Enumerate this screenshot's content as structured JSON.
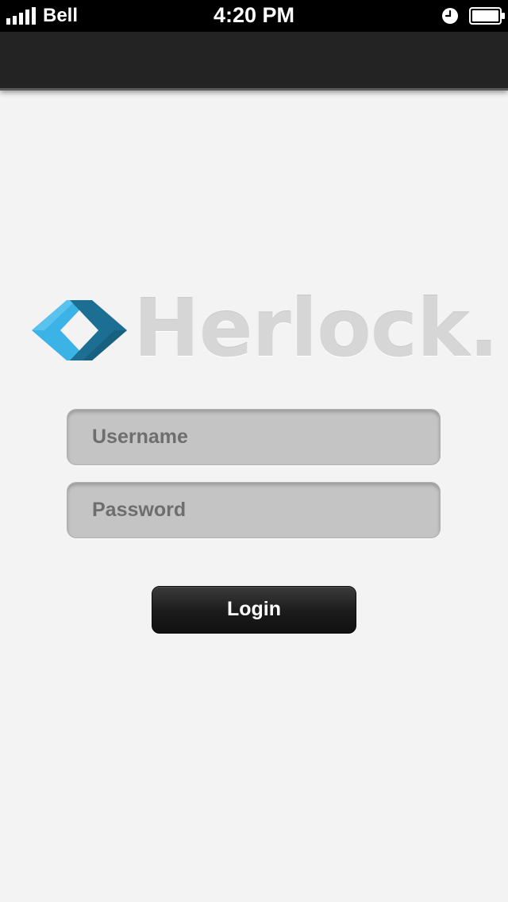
{
  "status_bar": {
    "carrier": "Bell",
    "time": "4:20 PM",
    "signal_icon": "signal-bars-icon",
    "alarm_icon": "alarm-clock-icon",
    "battery_icon": "battery-icon"
  },
  "nav_bar": {
    "background": "#232323"
  },
  "logo": {
    "text": "Herlock.",
    "mark_icon": "herlock-logo-mark-icon",
    "colors": {
      "mark_light": "#3bb3e6",
      "mark_dark": "#1c6f93",
      "wordmark": "#d6d6d6"
    }
  },
  "login_form": {
    "username_placeholder": "Username",
    "password_placeholder": "Password",
    "login_label": "Login"
  }
}
